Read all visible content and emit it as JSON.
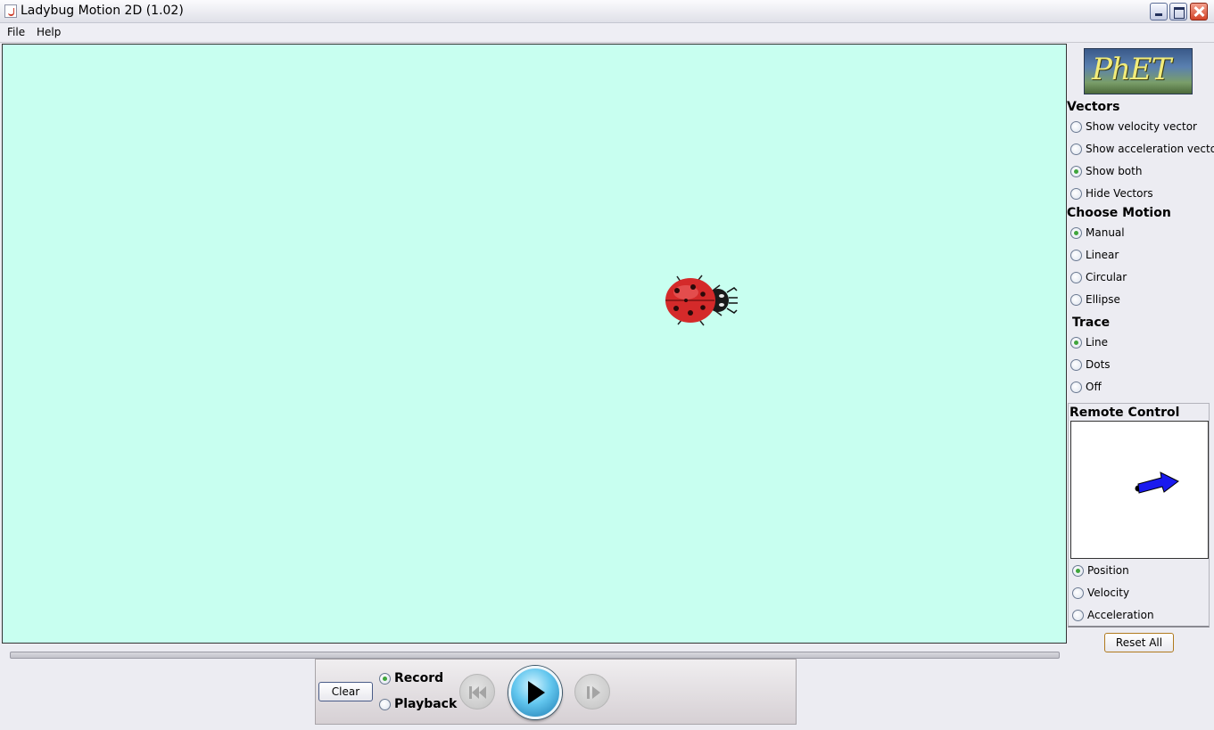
{
  "window": {
    "title": "Ladybug Motion 2D (1.02)"
  },
  "menu": {
    "file": "File",
    "help": "Help"
  },
  "panel": {
    "logo_text": "PhET",
    "vectors": {
      "title": "Vectors",
      "options": [
        {
          "label": "Show velocity vector",
          "checked": false
        },
        {
          "label": "Show acceleration vector",
          "checked": false
        },
        {
          "label": "Show both",
          "checked": true
        },
        {
          "label": "Hide Vectors",
          "checked": false
        }
      ]
    },
    "motion": {
      "title": "Choose Motion",
      "options": [
        {
          "label": "Manual",
          "checked": true
        },
        {
          "label": "Linear",
          "checked": false
        },
        {
          "label": "Circular",
          "checked": false
        },
        {
          "label": "Ellipse",
          "checked": false
        }
      ]
    },
    "trace": {
      "title": "Trace",
      "options": [
        {
          "label": "Line",
          "checked": true
        },
        {
          "label": "Dots",
          "checked": false
        },
        {
          "label": "Off",
          "checked": false
        }
      ]
    },
    "remote": {
      "title": "Remote Control",
      "options": [
        {
          "label": "Position",
          "checked": true
        },
        {
          "label": "Velocity",
          "checked": false
        },
        {
          "label": "Acceleration",
          "checked": false
        }
      ]
    },
    "reset_label": "Reset All"
  },
  "playback": {
    "clear_label": "Clear",
    "record_label": "Record",
    "playback_label": "Playback",
    "mode": "record"
  },
  "icons": [
    "app-icon",
    "ladybug-icon",
    "remote-arrow-icon",
    "rewind-icon",
    "play-icon",
    "step-forward-icon"
  ]
}
